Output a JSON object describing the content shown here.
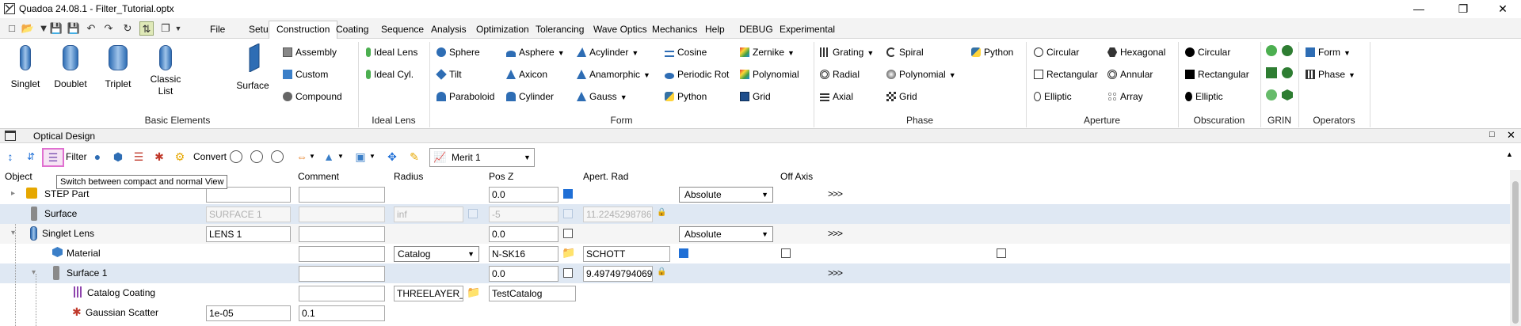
{
  "window": {
    "title": "Quadoa 24.08.1 - Filter_Tutorial.optx",
    "min_icon": "minimize-icon",
    "max_icon": "restore-icon",
    "close_icon": "close-icon"
  },
  "menu": {
    "tabs": [
      "File",
      "Setup",
      "Construction",
      "Coating",
      "Sequence",
      "Analysis",
      "Optimization",
      "Tolerancing",
      "Wave Optics",
      "Mechanics",
      "Help",
      "DEBUG",
      "Experimental"
    ],
    "active": "Construction"
  },
  "ribbon": {
    "basic_elements": {
      "label": "Basic Elements",
      "singlet": "Singlet",
      "doublet": "Doublet",
      "triplet": "Triplet",
      "classic_list": "Classic\nList",
      "surface": "Surface",
      "assembly": "Assembly",
      "custom": "Custom",
      "compound": "Compound"
    },
    "ideal_lens": {
      "label": "Ideal Lens",
      "ideal_lens": "Ideal Lens",
      "ideal_cyl": "Ideal Cyl."
    },
    "form": {
      "label": "Form",
      "sphere": "Sphere",
      "tilt": "Tilt",
      "paraboloid": "Paraboloid",
      "asphere": "Asphere",
      "axicon": "Axicon",
      "cylinder": "Cylinder",
      "acylinder": "Acylinder",
      "anamorphic": "Anamorphic",
      "gauss": "Gauss",
      "cosine": "Cosine",
      "periodic_rot": "Periodic Rot",
      "python": "Python",
      "zernike": "Zernike",
      "polynomial": "Polynomial",
      "grid": "Grid"
    },
    "phase": {
      "label": "Phase",
      "grating": "Grating",
      "radial": "Radial",
      "axial": "Axial",
      "spiral": "Spiral",
      "polynomial": "Polynomial",
      "grid": "Grid",
      "python": "Python"
    },
    "aperture": {
      "label": "Aperture",
      "circular": "Circular",
      "rectangular": "Rectangular",
      "elliptic": "Elliptic",
      "hexagonal": "Hexagonal",
      "annular": "Annular",
      "array": "Array"
    },
    "obscuration": {
      "label": "Obscuration",
      "circular": "Circular",
      "rectangular": "Rectangular",
      "elliptic": "Elliptic"
    },
    "grin": {
      "label": "GRIN"
    },
    "operators": {
      "label": "Operators",
      "form": "Form",
      "phase": "Phase"
    }
  },
  "panel": {
    "title": "Optical Design"
  },
  "toolbar": {
    "filter": "Filter",
    "convert": "Convert",
    "merit": "Merit 1",
    "tooltip": "Switch between compact and normal View"
  },
  "columns": {
    "object": "Object",
    "comment": "Comment",
    "radius": "Radius",
    "pos_z": "Pos Z",
    "apert_rad": "Apert. Rad",
    "off_axis": "Off Axis"
  },
  "rows": [
    {
      "label": "STEP Part",
      "pos_z": "0.0",
      "mode": "Absolute",
      "more": ">>>"
    },
    {
      "label": "Surface",
      "name": "SURFACE 1",
      "radius": "inf",
      "pos_z": "-5",
      "apert": "11.2245298786"
    },
    {
      "label": "Singlet Lens",
      "name": "LENS 1",
      "pos_z": "0.0",
      "mode": "Absolute",
      "more": ">>>"
    },
    {
      "label": "Material",
      "radius": "Catalog",
      "glass": "N-SK16",
      "catalog": "SCHOTT"
    },
    {
      "label": "Surface 1",
      "pos_z": "0.0",
      "apert": "9.49749794069",
      "more": ">>>"
    },
    {
      "label": "Catalog Coating",
      "radius": "THREELAYER_EX",
      "pos_z": "TestCatalog"
    },
    {
      "label": "Gaussian Scatter",
      "name": "1e-05",
      "comment": "0.1"
    }
  ],
  "colors": {
    "accent": "#1f6fd6",
    "selected_row": "#dfe8f3",
    "tooltip_highlight": "#e070d0"
  }
}
